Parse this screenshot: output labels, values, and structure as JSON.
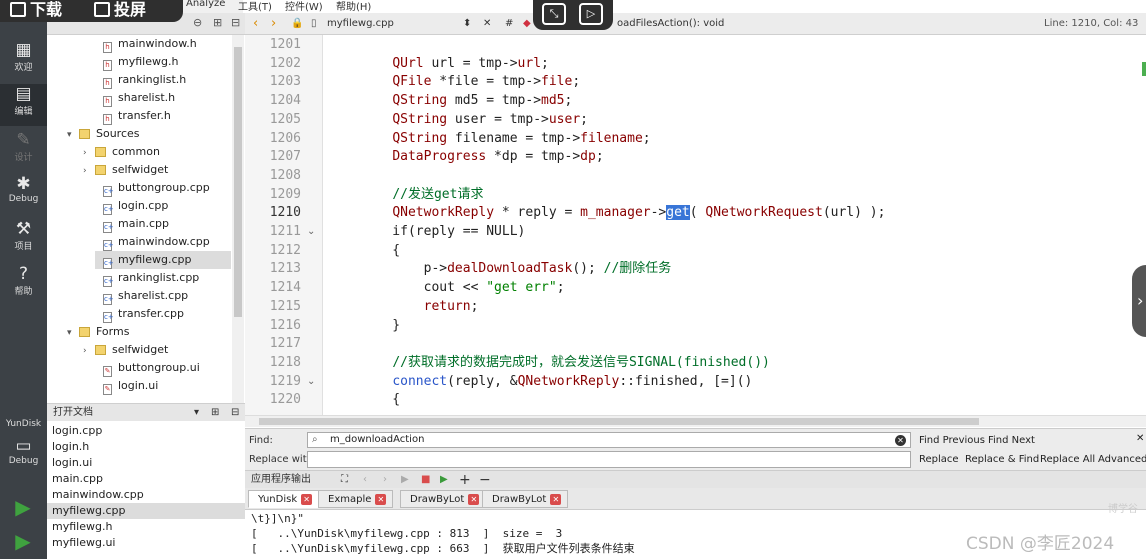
{
  "overlay": {
    "download": "下载",
    "cast": "投屏"
  },
  "menus": {
    "analyze": "Analyze",
    "tools": "工具(T)",
    "controls": "控件(W)",
    "help": "帮助(H)"
  },
  "modes": {
    "welcome": "欢迎",
    "edit": "编辑",
    "design": "设计",
    "debug": "Debug",
    "projects": "项目",
    "help": "帮助"
  },
  "kit": {
    "project_name": "YunDisk",
    "build_label": "Debug"
  },
  "tree": {
    "rows": [
      {
        "label": "mainwindow.h",
        "kind": "h",
        "indent": 2
      },
      {
        "label": "myfilewg.h",
        "kind": "h",
        "indent": 2
      },
      {
        "label": "rankinglist.h",
        "kind": "h",
        "indent": 2
      },
      {
        "label": "sharelist.h",
        "kind": "h",
        "indent": 2
      },
      {
        "label": "transfer.h",
        "kind": "h",
        "indent": 2
      },
      {
        "label": "Sources",
        "kind": "group",
        "indent": 1,
        "arrow": "▾"
      },
      {
        "label": "common",
        "kind": "folder",
        "indent": 2,
        "arrow": "›"
      },
      {
        "label": "selfwidget",
        "kind": "folder",
        "indent": 2,
        "arrow": "›"
      },
      {
        "label": "buttongroup.cpp",
        "kind": "cpp",
        "indent": 2
      },
      {
        "label": "login.cpp",
        "kind": "cpp",
        "indent": 2
      },
      {
        "label": "main.cpp",
        "kind": "cpp",
        "indent": 2
      },
      {
        "label": "mainwindow.cpp",
        "kind": "cpp",
        "indent": 2
      },
      {
        "label": "myfilewg.cpp",
        "kind": "cpp",
        "indent": 2,
        "selected": true
      },
      {
        "label": "rankinglist.cpp",
        "kind": "cpp",
        "indent": 2
      },
      {
        "label": "sharelist.cpp",
        "kind": "cpp",
        "indent": 2
      },
      {
        "label": "transfer.cpp",
        "kind": "cpp",
        "indent": 2
      },
      {
        "label": "Forms",
        "kind": "group",
        "indent": 1,
        "arrow": "▾"
      },
      {
        "label": "selfwidget",
        "kind": "folder",
        "indent": 2,
        "arrow": "›"
      },
      {
        "label": "buttongroup.ui",
        "kind": "ui",
        "indent": 2
      },
      {
        "label": "login.ui",
        "kind": "ui",
        "indent": 2
      }
    ]
  },
  "open_docs": {
    "title": "打开文档",
    "items": [
      "login.cpp",
      "login.h",
      "login.ui",
      "main.cpp",
      "mainwindow.cpp",
      "myfilewg.cpp",
      "myfilewg.h",
      "myfilewg.ui"
    ],
    "selected": 5
  },
  "editor": {
    "file": "myfilewg.cpp",
    "function": "oadFilesAction(): void",
    "position": "Line: 1210, Col: 43",
    "current_line": 1210,
    "lines": [
      {
        "n": 1201,
        "html": ""
      },
      {
        "n": 1202,
        "html": "    <span class='cp'>QUrl</span> url = tmp-><span class='cp'>url</span>;"
      },
      {
        "n": 1203,
        "html": "    <span class='cp'>QFile</span> *file = tmp-><span class='cp'>file</span>;"
      },
      {
        "n": 1204,
        "html": "    <span class='cp'>QString</span> md5 = tmp-><span class='cp'>md5</span>;"
      },
      {
        "n": 1205,
        "html": "    <span class='cp'>QString</span> user = tmp-><span class='cp'>user</span>;"
      },
      {
        "n": 1206,
        "html": "    <span class='cp'>QString</span> filename = tmp-><span class='cp'>filename</span>;"
      },
      {
        "n": 1207,
        "html": "    <span class='cp'>DataProgress</span> *dp = tmp-><span class='cp'>dp</span>;"
      },
      {
        "n": 1208,
        "html": ""
      },
      {
        "n": 1209,
        "html": "    <span class='cm'>//发送get请求</span>"
      },
      {
        "n": 1210,
        "html": "    <span class='cp'>QNetworkReply</span> * reply = <span class='cp'>m_manager</span>-><span class='hl'>get</span>( <span class='cp'>QNetworkRequest</span>(url) );"
      },
      {
        "n": 1211,
        "html": "    if(reply == NULL)",
        "fold": true
      },
      {
        "n": 1212,
        "html": "    {"
      },
      {
        "n": 1213,
        "html": "        p-><span class='cp'>dealDownloadTask</span>(); <span class='cm'>//删除任务</span>"
      },
      {
        "n": 1214,
        "html": "        cout << <span class='str'>\"get err\"</span>;"
      },
      {
        "n": 1215,
        "html": "        <span class='cp'>return</span>;"
      },
      {
        "n": 1216,
        "html": "    }"
      },
      {
        "n": 1217,
        "html": ""
      },
      {
        "n": 1218,
        "html": "    <span class='cm'>//获取请求的数据完成时，就会发送信号SIGNAL(finished())</span>"
      },
      {
        "n": 1219,
        "html": "    <span class='kw'>connect</span>(reply, &<span class='cp'>QNetworkReply</span>::finished, [=]()",
        "fold": true
      },
      {
        "n": 1220,
        "html": "    {"
      }
    ]
  },
  "find": {
    "find_label": "Find:",
    "replace_label": "Replace with:",
    "query": "m_downloadAction",
    "find_previous": "Find Previous",
    "find_next": "Find Next",
    "replace": "Replace",
    "replace_find": "Replace & Find",
    "replace_all": "Replace All",
    "advanced": "Advanced..."
  },
  "output": {
    "pane_title": "应用程序输出",
    "tabs": [
      "YunDisk",
      "Exmaple",
      "DrawByLot",
      "DrawByLot"
    ],
    "lines": [
      "\\t}]\\n}\"",
      "[   ..\\YunDisk\\myfilewg.cpp : 813  ]  size =  3",
      "[   ..\\YunDisk\\myfilewg.cpp : 663  ]  获取用户文件列表条件结束"
    ]
  },
  "watermark": "CSDN @李匠2024",
  "watermark2": "博学谷"
}
